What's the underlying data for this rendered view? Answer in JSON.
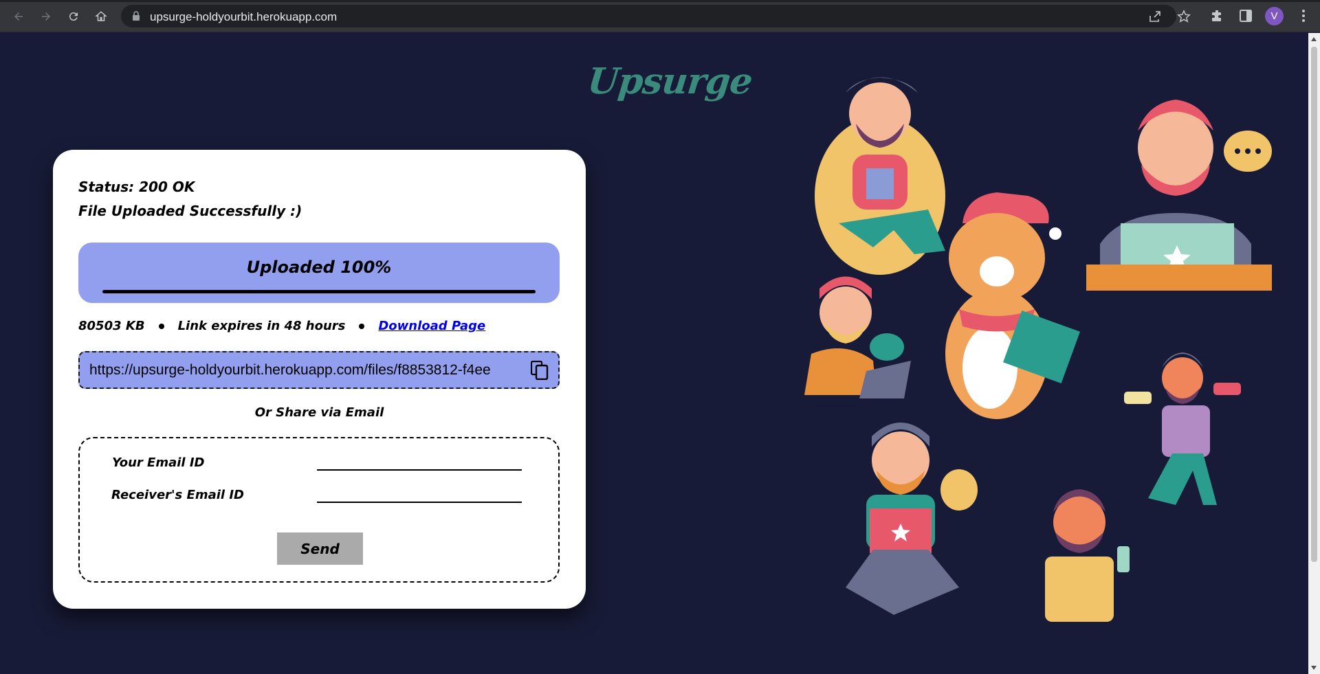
{
  "browser": {
    "url": "upsurge-holdyourbit.herokuapp.com",
    "profile_initial": "V"
  },
  "logo": "Upsurge",
  "card": {
    "status": "Status: 200 OK",
    "message": "File Uploaded Successfully :)",
    "progress_label": "Uploaded 100%",
    "progress_fraction": 1.0,
    "file_size": "80503 KB",
    "expiry": "Link expires in 48 hours",
    "download_link": "Download Page",
    "share_url": "https://upsurge-holdyourbit.herokuapp.com/files/f8853812-f4ee",
    "or_share": "Or Share via Email",
    "your_email_label": "Your Email ID",
    "receiver_email_label": "Receiver's Email ID",
    "send_label": "Send"
  },
  "colors": {
    "page_bg": "#181b37",
    "progress_bg": "#929fef",
    "logo": "#3a8b7b",
    "send_bg": "#aaaaaa"
  }
}
